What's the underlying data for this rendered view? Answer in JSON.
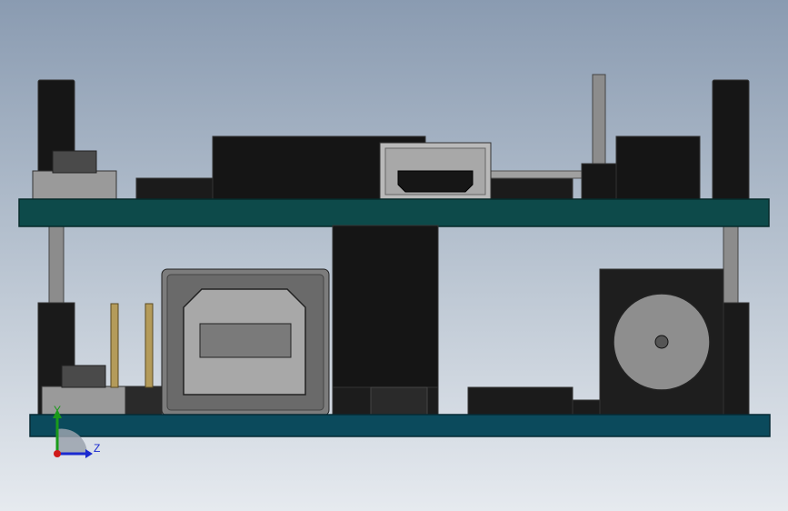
{
  "triad": {
    "y_label": "Y",
    "z_label": "Z"
  },
  "colors": {
    "background_top": "#8a9bb1",
    "background_bottom": "#e6eaef",
    "pcb_top": "#0d4a4a",
    "pcb_bottom": "#0b4a5c",
    "component_dark": "#161616",
    "component_gray": "#8c8c8c",
    "header_pin": "#b49b5a",
    "axis_y": "#1a9a1a",
    "axis_z": "#1a2ad0",
    "origin": "#d01a1a"
  }
}
